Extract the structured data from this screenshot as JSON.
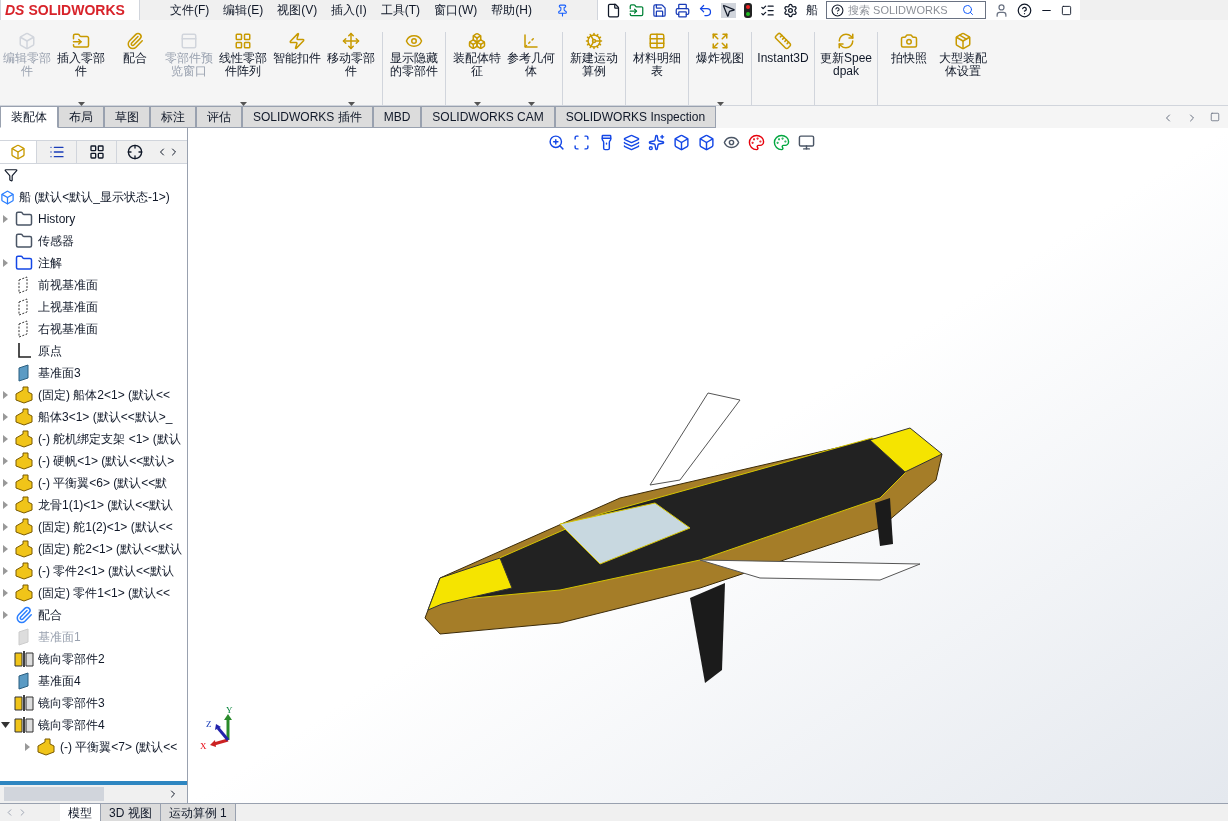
{
  "app": {
    "logo_prefix": "DS",
    "logo_name": "SOLIDWORKS"
  },
  "menu": [
    "文件(F)",
    "编辑(E)",
    "视图(V)",
    "插入(I)",
    "工具(T)",
    "窗口(W)",
    "帮助(H)"
  ],
  "document_title": "船",
  "search": {
    "placeholder": "搜索 SOLIDWORKS"
  },
  "ribbon": [
    {
      "label": "编辑零部件",
      "disabled": true,
      "has_menu": false
    },
    {
      "label": "插入零部件",
      "disabled": false,
      "has_menu": true
    },
    {
      "label": "配合",
      "disabled": false,
      "has_menu": false
    },
    {
      "label": "零部件预览窗口",
      "disabled": true,
      "has_menu": false
    },
    {
      "label": "线性零部件阵列",
      "disabled": false,
      "has_menu": true
    },
    {
      "label": "智能扣件",
      "disabled": false,
      "has_menu": false
    },
    {
      "label": "移动零部件",
      "disabled": false,
      "has_menu": true
    },
    {
      "label": "显示隐藏的零部件",
      "disabled": false,
      "has_menu": false
    },
    {
      "label": "装配体特征",
      "disabled": false,
      "has_menu": true
    },
    {
      "label": "参考几何体",
      "disabled": false,
      "has_menu": true
    },
    {
      "label": "新建运动算例",
      "disabled": false,
      "has_menu": false
    },
    {
      "label": "材料明细表",
      "disabled": false,
      "has_menu": false
    },
    {
      "label": "爆炸视图",
      "disabled": false,
      "has_menu": true
    },
    {
      "label": "Instant3D",
      "disabled": false,
      "has_menu": false
    },
    {
      "label": "更新Speedpak",
      "disabled": false,
      "has_menu": false
    },
    {
      "label": "拍快照",
      "disabled": false,
      "has_menu": false
    },
    {
      "label": "大型装配体设置",
      "disabled": false,
      "has_menu": false
    }
  ],
  "tabs": [
    {
      "label": "装配体",
      "selected": true
    },
    {
      "label": "布局",
      "selected": false
    },
    {
      "label": "草图",
      "selected": false
    },
    {
      "label": "标注",
      "selected": false
    },
    {
      "label": "评估",
      "selected": false
    },
    {
      "label": "SOLIDWORKS 插件",
      "selected": false
    },
    {
      "label": "MBD",
      "selected": false
    },
    {
      "label": "SOLIDWORKS CAM",
      "selected": false
    },
    {
      "label": "SOLIDWORKS Inspection",
      "selected": false
    }
  ],
  "tree": {
    "root": "船 (默认<默认_显示状态-1>)",
    "items": [
      {
        "kind": "history",
        "label": "History",
        "expanded": false,
        "disabled": false
      },
      {
        "kind": "sensor",
        "label": "传感器",
        "disabled": false
      },
      {
        "kind": "annotation",
        "label": "注解",
        "expanded": false,
        "disabled": false
      },
      {
        "kind": "plane",
        "label": "前视基准面",
        "disabled": false
      },
      {
        "kind": "plane",
        "label": "上视基准面",
        "disabled": false
      },
      {
        "kind": "plane",
        "label": "右视基准面",
        "disabled": false
      },
      {
        "kind": "origin",
        "label": "原点",
        "disabled": false
      },
      {
        "kind": "refplane",
        "label": "基准面3",
        "disabled": false
      },
      {
        "kind": "part",
        "label": "(固定) 船体2<1> (默认<<",
        "expanded": false,
        "disabled": false
      },
      {
        "kind": "part",
        "label": "船体3<1> (默认<<默认>_",
        "expanded": false,
        "disabled": false
      },
      {
        "kind": "part",
        "label": "(-) 舵机绑定支架 <1> (默认",
        "expanded": false,
        "disabled": false
      },
      {
        "kind": "part",
        "label": "(-) 硬帆<1> (默认<<默认>",
        "expanded": false,
        "disabled": false
      },
      {
        "kind": "part",
        "label": "(-) 平衡翼<6> (默认<<默",
        "expanded": false,
        "disabled": false
      },
      {
        "kind": "part",
        "label": "龙骨1(1)<1> (默认<<默认",
        "expanded": false,
        "disabled": false
      },
      {
        "kind": "part",
        "label": "(固定) 舵1(2)<1> (默认<<",
        "expanded": false,
        "disabled": false
      },
      {
        "kind": "part",
        "label": "(固定) 舵2<1> (默认<<默认",
        "expanded": false,
        "disabled": false
      },
      {
        "kind": "part",
        "label": "(-) 零件2<1> (默认<<默认",
        "expanded": false,
        "disabled": false
      },
      {
        "kind": "part",
        "label": "(固定) 零件1<1> (默认<<",
        "expanded": false,
        "disabled": false
      },
      {
        "kind": "mate",
        "label": "配合",
        "expanded": false,
        "disabled": false
      },
      {
        "kind": "refplane",
        "label": "基准面1",
        "disabled": true
      },
      {
        "kind": "mirror",
        "label": "镜向零部件2",
        "disabled": false
      },
      {
        "kind": "refplane",
        "label": "基准面4",
        "disabled": false
      },
      {
        "kind": "mirror",
        "label": "镜向零部件3",
        "disabled": false
      },
      {
        "kind": "mirror",
        "label": "镜向零部件4",
        "expanded": true,
        "disabled": false,
        "children": [
          {
            "kind": "part",
            "label": "(-) 平衡翼<7> (默认<<",
            "expanded": false,
            "disabled": false
          }
        ]
      }
    ]
  },
  "triad": {
    "x": "X",
    "y": "Y",
    "z": "Z"
  },
  "bottom_tabs": [
    {
      "label": "模型",
      "selected": true
    },
    {
      "label": "3D 视图",
      "selected": false
    },
    {
      "label": "运动算例 1",
      "selected": false
    }
  ]
}
